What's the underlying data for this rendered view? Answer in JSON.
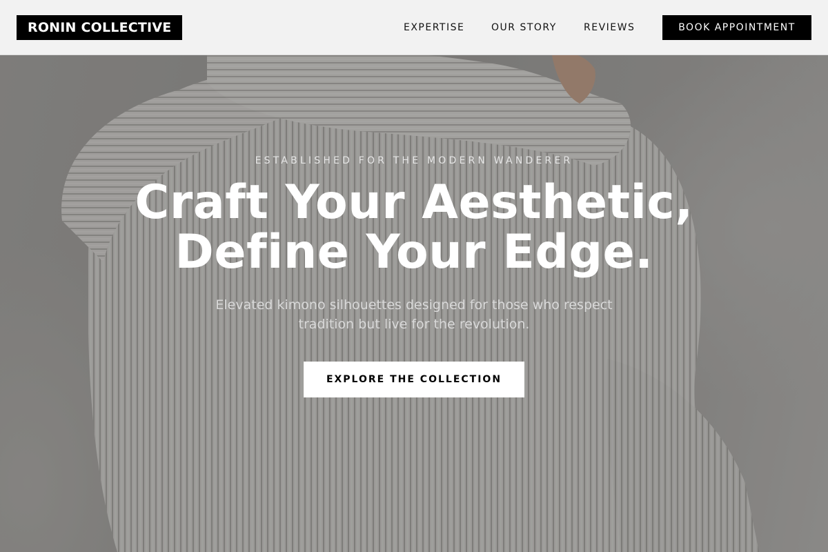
{
  "header": {
    "brand": "RONIN COLLECTIVE",
    "nav": [
      {
        "label": "EXPERTISE"
      },
      {
        "label": "OUR STORY"
      },
      {
        "label": "REVIEWS"
      }
    ],
    "cta_label": "BOOK APPOINTMENT"
  },
  "hero": {
    "background_image": "knit sweater photo",
    "eyebrow": "ESTABLISHED FOR THE MODERN WANDERER",
    "headline_lines": [
      "Craft Your Aesthetic,",
      "Define Your Edge."
    ],
    "subtext_lines": [
      "Elevated kimono silhouettes designed for those who respect",
      "tradition but live for the revolution."
    ],
    "cta_label": "EXPLORE THE COLLECTION"
  },
  "colors": {
    "header_bg": "#f2f2f2",
    "brand_bg": "#000000",
    "brand_text": "#ffffff",
    "primary_button_bg": "#000000",
    "hero_button_bg": "#ffffff",
    "hero_text": "#ffffff"
  }
}
